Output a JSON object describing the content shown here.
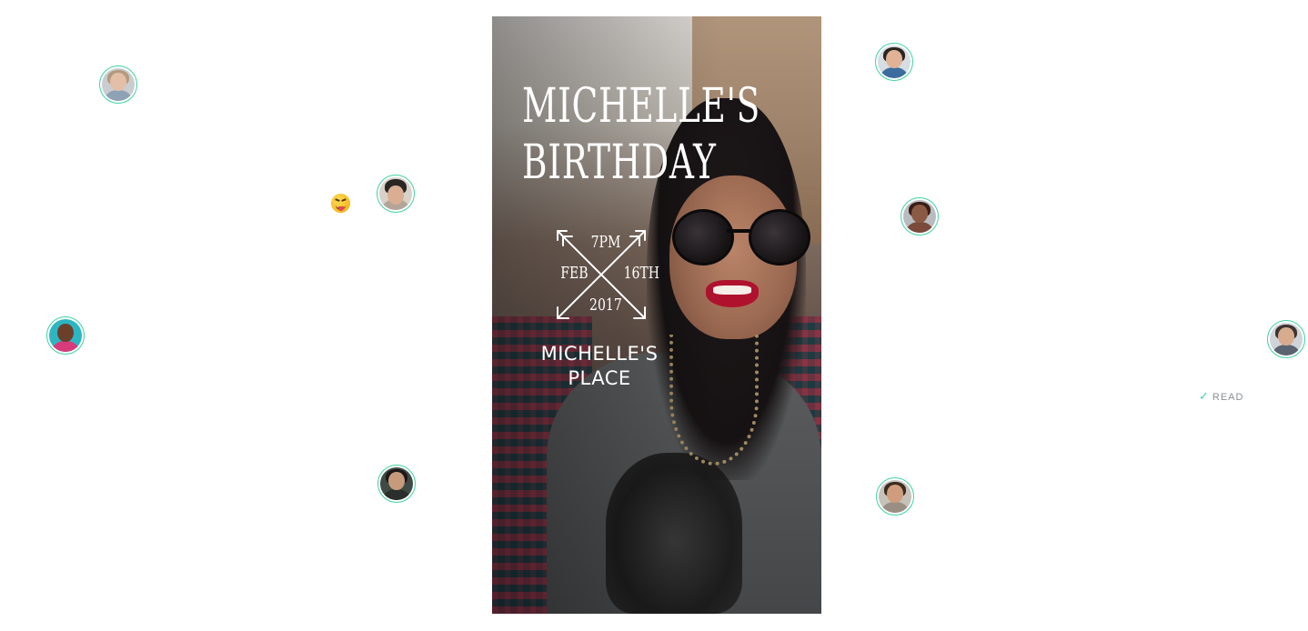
{
  "story": {
    "title_line1": "MICHELLE'S",
    "title_line2": "BIRTHDAY",
    "time": "7PM",
    "month": "FEB",
    "day": "16TH",
    "year": "2017",
    "place_line1": "MICHELLE'S",
    "place_line2": "PLACE"
  },
  "reaction": {
    "emoji": "squinting-face-with-tongue-icon"
  },
  "read_status": {
    "label": "READ",
    "icon": "checkmark-icon"
  },
  "colors": {
    "accent": "#3ed3a0",
    "muted_text": "#8a8f95",
    "background": "#ffffff"
  }
}
